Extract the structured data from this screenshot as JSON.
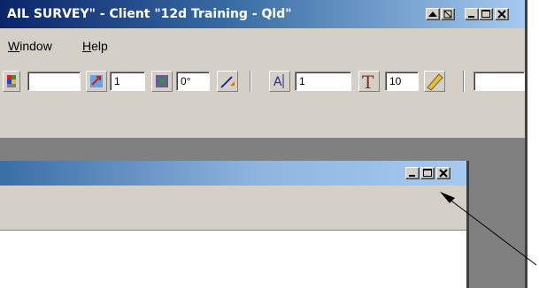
{
  "window": {
    "title": "AIL SURVEY\" - Client \"12d Training - Qld\""
  },
  "menubar": {
    "items": [
      {
        "label": "Window",
        "mnemonic": "W",
        "rest": "indow"
      },
      {
        "label": "Help",
        "mnemonic": "H",
        "rest": "elp"
      }
    ]
  },
  "toolbar": {
    "field_1": "",
    "field_2": "1",
    "field_3": "0°",
    "field_4": "1",
    "field_5": "10",
    "field_6": ""
  },
  "colors": {
    "title_active": "#0a246a",
    "title_fade": "#a6caf0",
    "face": "#d4d0c8",
    "workspace": "#808080"
  }
}
